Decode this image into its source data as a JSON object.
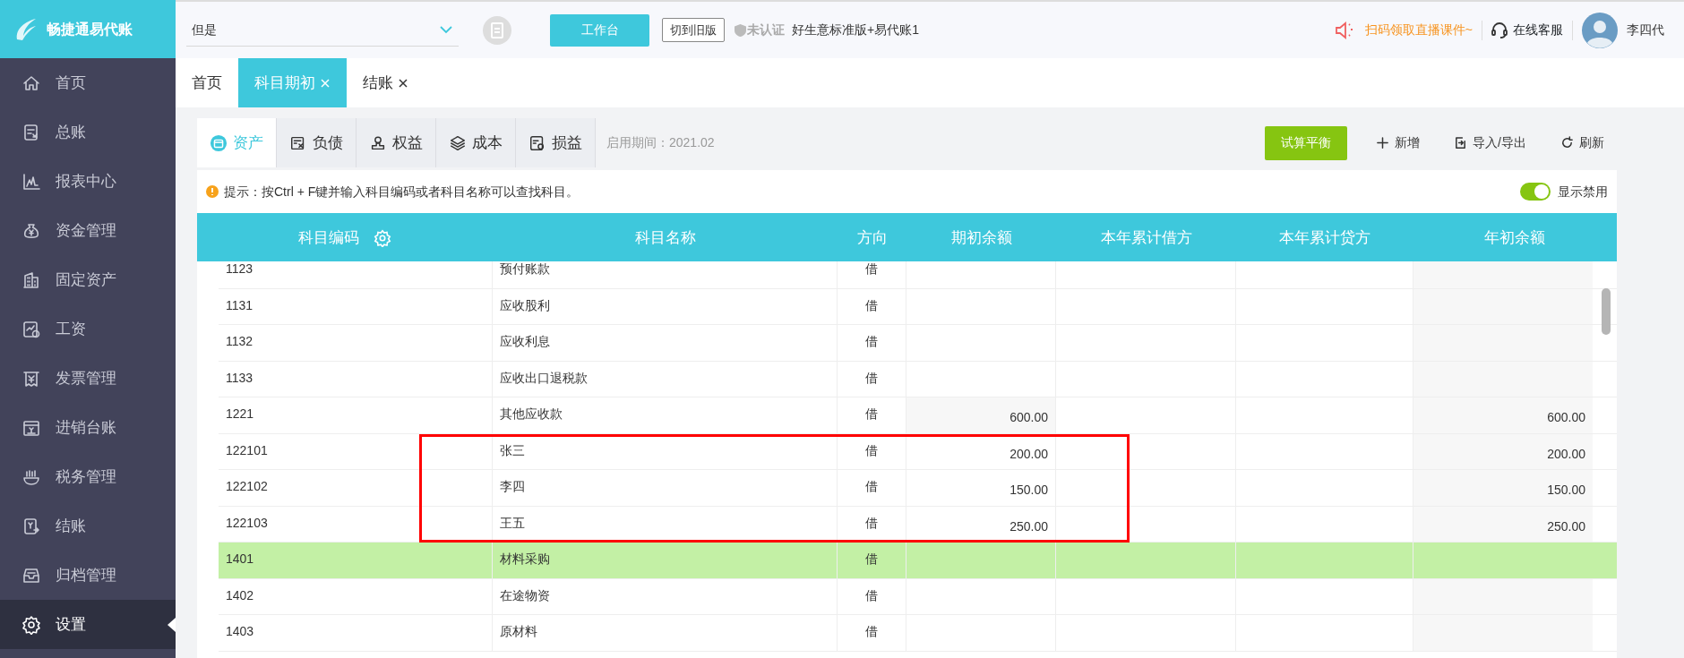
{
  "app": {
    "logo_text": "畅捷通易代账"
  },
  "top_bar": {
    "company_select": {
      "value": "但是"
    },
    "workbench_button": "工作台",
    "switch_button": "切到旧版",
    "certification": "未认证",
    "product": "好生意标准版+易代账1",
    "promo": "扫码领取直播课件~",
    "support": "在线客服",
    "user": "李四代"
  },
  "sidebar": {
    "items": [
      {
        "label": "首页",
        "selected": false
      },
      {
        "label": "总账",
        "selected": false
      },
      {
        "label": "报表中心",
        "selected": false
      },
      {
        "label": "资金管理",
        "selected": false
      },
      {
        "label": "固定资产",
        "selected": false
      },
      {
        "label": "工资",
        "selected": false
      },
      {
        "label": "发票管理",
        "selected": false
      },
      {
        "label": "进销台账",
        "selected": false
      },
      {
        "label": "税务管理",
        "selected": false
      },
      {
        "label": "结账",
        "selected": false
      },
      {
        "label": "归档管理",
        "selected": false
      },
      {
        "label": "设置",
        "selected": true
      }
    ]
  },
  "page_tabs": [
    {
      "label": "首页",
      "closable": false,
      "selected": false
    },
    {
      "label": "科目期初",
      "closable": true,
      "selected": true
    },
    {
      "label": "结账",
      "closable": true,
      "selected": false
    }
  ],
  "category_tabs": [
    {
      "label": "资产",
      "selected": true
    },
    {
      "label": "负债",
      "selected": false
    },
    {
      "label": "权益",
      "selected": false
    },
    {
      "label": "成本",
      "selected": false
    },
    {
      "label": "损益",
      "selected": false
    }
  ],
  "period": "启用期间：2021.02",
  "actions": [
    {
      "label": "试算平衡",
      "kind": "primary"
    },
    {
      "label": "新增",
      "kind": "add"
    },
    {
      "label": "导入/导出",
      "kind": "import"
    },
    {
      "label": "刷新",
      "kind": "refresh"
    }
  ],
  "hint": "提示：按Ctrl + F键并输入科目编码或者科目名称可以查找科目。",
  "show_disabled": {
    "label": "显示禁用",
    "on": true
  },
  "table": {
    "columns": [
      "科目编码",
      "科目名称",
      "方向",
      "期初余额",
      "本年累计借方",
      "本年累计贷方",
      "年初余额"
    ],
    "rows": [
      {
        "code": "1123",
        "name": "预付账款",
        "direction": "借",
        "selected": false,
        "calculated": false
      },
      {
        "code": "1131",
        "name": "应收股利",
        "direction": "借",
        "selected": false,
        "calculated": false
      },
      {
        "code": "1132",
        "name": "应收利息",
        "direction": "借",
        "selected": false,
        "calculated": false
      },
      {
        "code": "1133",
        "name": "应收出口退税款",
        "direction": "借",
        "selected": false,
        "calculated": false
      },
      {
        "code": "1221",
        "name": "其他应收款",
        "direction": "借",
        "opening_balance": "600.00",
        "year_start_balance": "600.00",
        "selected": false,
        "calculated": true
      },
      {
        "code": "122101",
        "name": "张三",
        "direction": "借",
        "opening_balance": "200.00",
        "year_start_balance": "200.00",
        "selected": false,
        "calculated": false
      },
      {
        "code": "122102",
        "name": "李四",
        "direction": "借",
        "opening_balance": "150.00",
        "year_start_balance": "150.00",
        "selected": false,
        "calculated": false
      },
      {
        "code": "122103",
        "name": "王五",
        "direction": "借",
        "opening_balance": "250.00",
        "year_start_balance": "250.00",
        "selected": false,
        "calculated": false
      },
      {
        "code": "1401",
        "name": "材料采购",
        "direction": "借",
        "selected": true,
        "calculated": false
      },
      {
        "code": "1402",
        "name": "在途物资",
        "direction": "借",
        "selected": false,
        "calculated": false
      },
      {
        "code": "1403",
        "name": "原材料",
        "direction": "借",
        "selected": false,
        "calculated": false
      }
    ]
  }
}
